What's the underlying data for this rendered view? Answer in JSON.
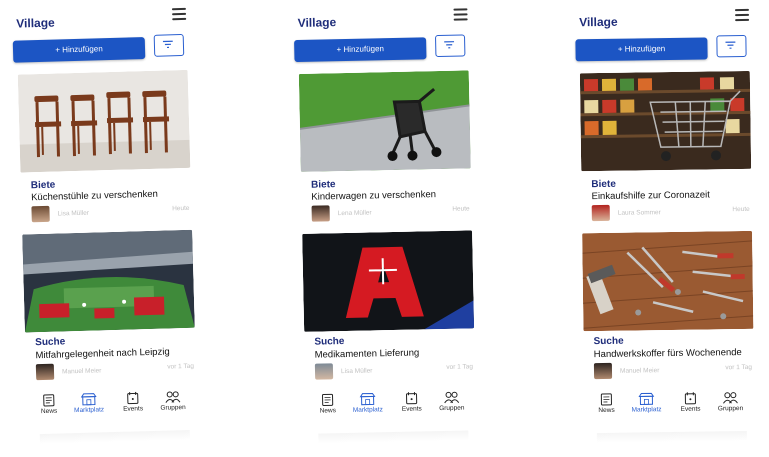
{
  "screens": [
    {
      "logo": "Village",
      "add_label": "+ Hinzufügen",
      "cards": [
        {
          "category": "Biete",
          "title": "Küchenstühle zu verschenken",
          "author": "Lisa Müller",
          "time": "Heute",
          "image": "chairs"
        },
        {
          "category": "Suche",
          "title": "Mitfahrgelegenheit nach Leipzig",
          "author": "Manuel Meier",
          "time": "vor 1 Tag",
          "image": "stadium"
        }
      ]
    },
    {
      "logo": "Village",
      "add_label": "+ Hinzufügen",
      "cards": [
        {
          "category": "Biete",
          "title": "Kinderwagen zu verschenken",
          "author": "Lena Müller",
          "time": "Heute",
          "image": "stroller"
        },
        {
          "category": "Suche",
          "title": "Medikamenten Lieferung",
          "author": "Lisa Müller",
          "time": "vor 1 Tag",
          "image": "pharmacy"
        }
      ]
    },
    {
      "logo": "Village",
      "add_label": "+ Hinzufügen",
      "cards": [
        {
          "category": "Biete",
          "title": "Einkaufshilfe zur Coronazeit",
          "author": "Laura Sommer",
          "time": "Heute",
          "image": "supermarket"
        },
        {
          "category": "Suche",
          "title": "Handwerkskoffer fürs Wochenende",
          "author": "Manuel Meier",
          "time": "vor 1 Tag",
          "image": "tools"
        }
      ]
    }
  ],
  "tabs": [
    {
      "label": "News",
      "icon": "news-icon"
    },
    {
      "label": "Marktplatz",
      "icon": "marketplace-icon",
      "active": true
    },
    {
      "label": "Events",
      "icon": "calendar-icon"
    },
    {
      "label": "Gruppen",
      "icon": "groups-icon"
    }
  ],
  "colors": {
    "brand": "#1f2d7a",
    "button": "#1c55c4",
    "active_tab": "#2a5fd0"
  }
}
